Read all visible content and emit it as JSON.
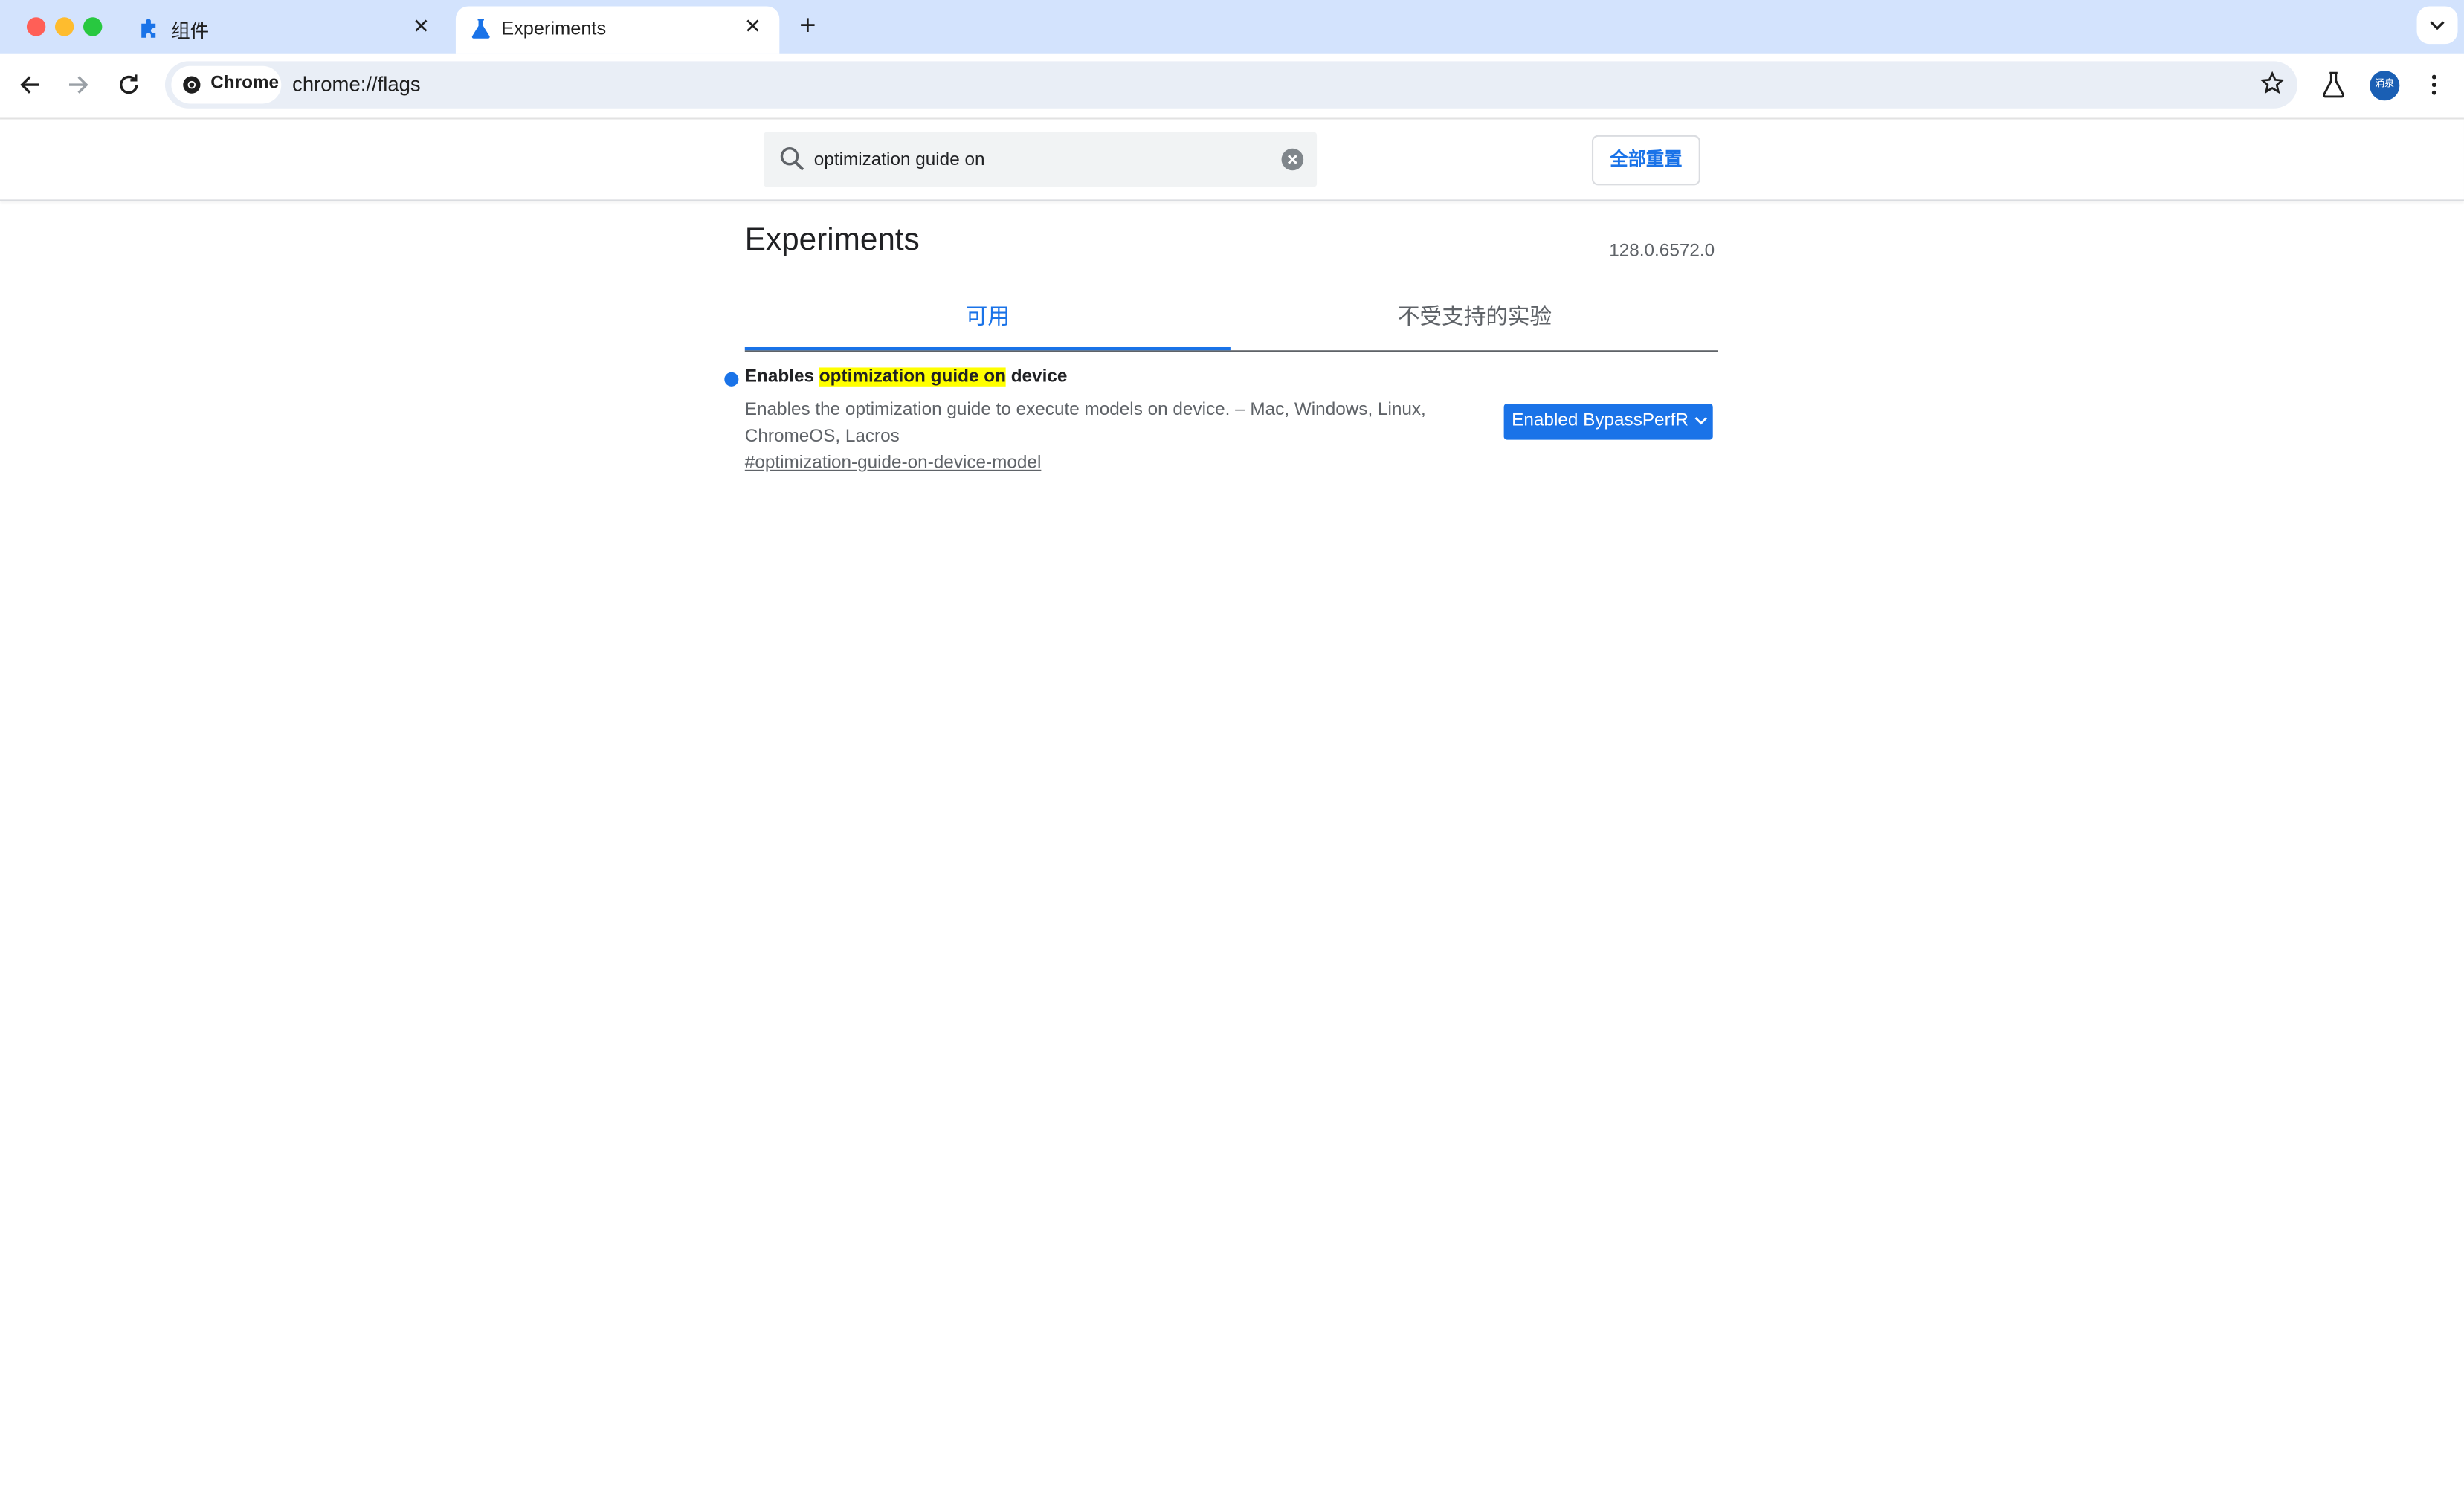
{
  "browser": {
    "tabs": [
      {
        "title": "组件",
        "icon": "puzzle-icon"
      },
      {
        "title": "Experiments",
        "icon": "flask-icon"
      }
    ],
    "chip_label": "Chrome",
    "url": "chrome://flags",
    "avatar_text": "涌泉"
  },
  "flags": {
    "search": {
      "value": "optimization guide on",
      "placeholder": "Search flags"
    },
    "reset_all_label": "全部重置",
    "page_title": "Experiments",
    "version": "128.0.6572.0",
    "tabs": {
      "available": "可用",
      "unsupported": "不受支持的实验"
    },
    "experiment": {
      "title_prefix": "Enables ",
      "title_highlight": "optimization guide on",
      "title_suffix": " device",
      "description": "Enables the optimization guide to execute models on device. – Mac, Windows, Linux, ChromeOS, Lacros",
      "link": "#optimization-guide-on-device-model",
      "selected_option": "Enabled BypassPerfR"
    }
  },
  "colors": {
    "tabstrip": "#d3e3fd",
    "accent": "#1a73e8",
    "highlight": "#ffff00"
  }
}
